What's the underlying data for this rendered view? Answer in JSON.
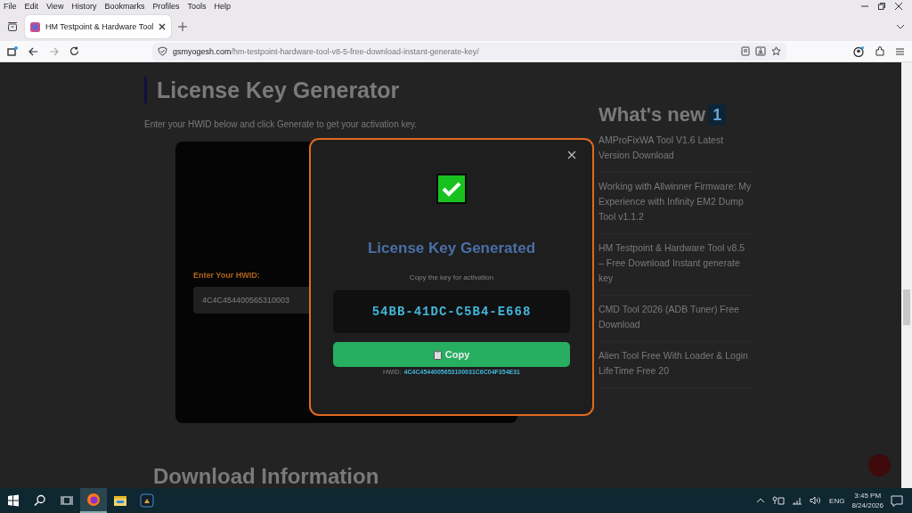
{
  "menu_bar": [
    "File",
    "Edit",
    "View",
    "History",
    "Bookmarks",
    "Profiles",
    "Tools",
    "Help"
  ],
  "tabs": [
    {
      "title": "HM Testpoint & Hardware Tool",
      "selected": true
    }
  ],
  "address_bar": {
    "domain": "gsmyogesh.com",
    "path": "/hm-testpoint-hardware-tool-v8-5-free-download-instant-generate-key/"
  },
  "page": {
    "heading": "License Key Generator",
    "intro": "Enter your HWID below and click Generate to get your activation key.",
    "form": {
      "label": "Enter Your HWID:",
      "value": "4C4C454400565310003"
    },
    "sidebar": {
      "title": "What's new",
      "badge": "1",
      "items": [
        {
          "title": "AMProFixWA Tool V1.6 Latest Version Download"
        },
        {
          "title": "Working with Allwinner Firmware: My Experience with Infinity EM2 Dump Tool v1.1.2"
        },
        {
          "title": "HM Testpoint & Hardware Tool v8.5 – Free Download Instant generate key"
        },
        {
          "title": "CMD Tool 2026 (ADB Tuner) Free Download"
        },
        {
          "title": "Alien Tool Free With Loader & Login LifeTime Free 20"
        }
      ]
    },
    "next_heading": "Download Information"
  },
  "modal": {
    "title": "License Key Generated",
    "subtitle": "Copy the key for activation",
    "key": "54BB-41DC-C5B4-E668",
    "copy_button": "Copy",
    "hwid_label": "HWID:",
    "hwid_value": "4C4C4544005653100031C6C04F354E31"
  },
  "taskbar": {
    "language": "ENG",
    "time": "3:45 PM",
    "date": "8/24/2026"
  }
}
